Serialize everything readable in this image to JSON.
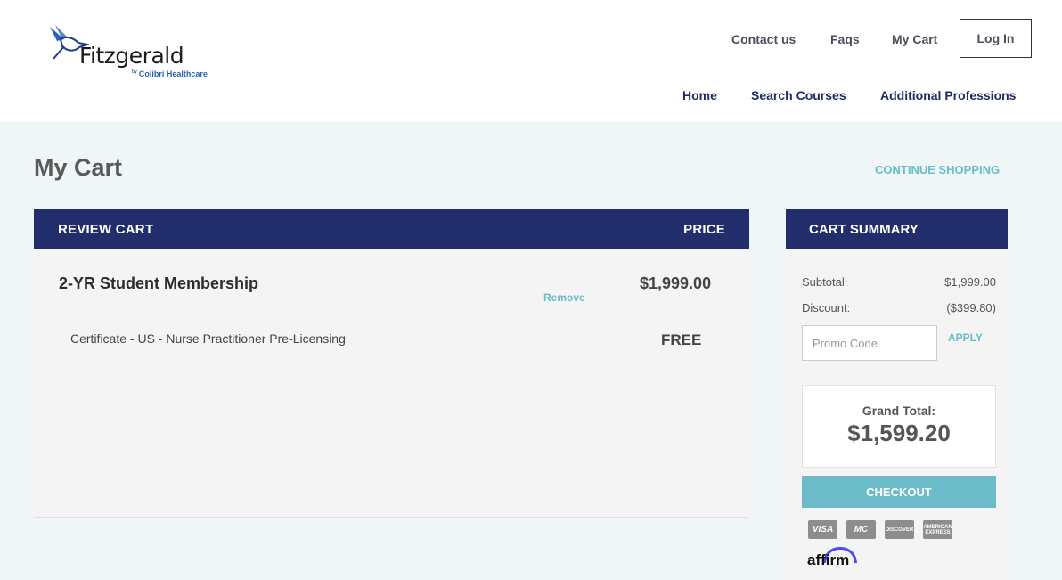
{
  "brand": {
    "name": "Fitzgerald",
    "tagline_prefix": "by",
    "tagline": "Colibri Healthcare"
  },
  "topnav": {
    "contact": "Contact us",
    "faqs": "Faqs",
    "cart": "My Cart",
    "login": "Log In"
  },
  "mainnav": {
    "home": "Home",
    "search": "Search Courses",
    "additional": "Additional Professions"
  },
  "page": {
    "title": "My Cart",
    "continue": "CONTINUE SHOPPING"
  },
  "cart": {
    "header_left": "REVIEW CART",
    "header_right": "PRICE",
    "item": {
      "name": "2-YR Student Membership",
      "remove": "Remove",
      "price": "$1,999.00"
    },
    "subitem": {
      "name": "Certificate - US - Nurse Practitioner Pre-Licensing",
      "price": "FREE"
    }
  },
  "summary": {
    "header": "CART SUMMARY",
    "subtotal_label": "Subtotal:",
    "subtotal_value": "$1,999.00",
    "discount_label": "Discount:",
    "discount_value": "($399.80)",
    "promo_placeholder": "Promo Code",
    "apply": "APPLY",
    "grand_label": "Grand Total:",
    "grand_value": "$1,599.20",
    "checkout": "CHECKOUT",
    "cards": [
      "VISA",
      "MC",
      "DISCOVER",
      "AMERICAN EXPRESS"
    ],
    "affirm": "affirm"
  },
  "colors": {
    "navy": "#222e6b",
    "teal": "#6bbbc9",
    "background": "#eef6f7"
  }
}
